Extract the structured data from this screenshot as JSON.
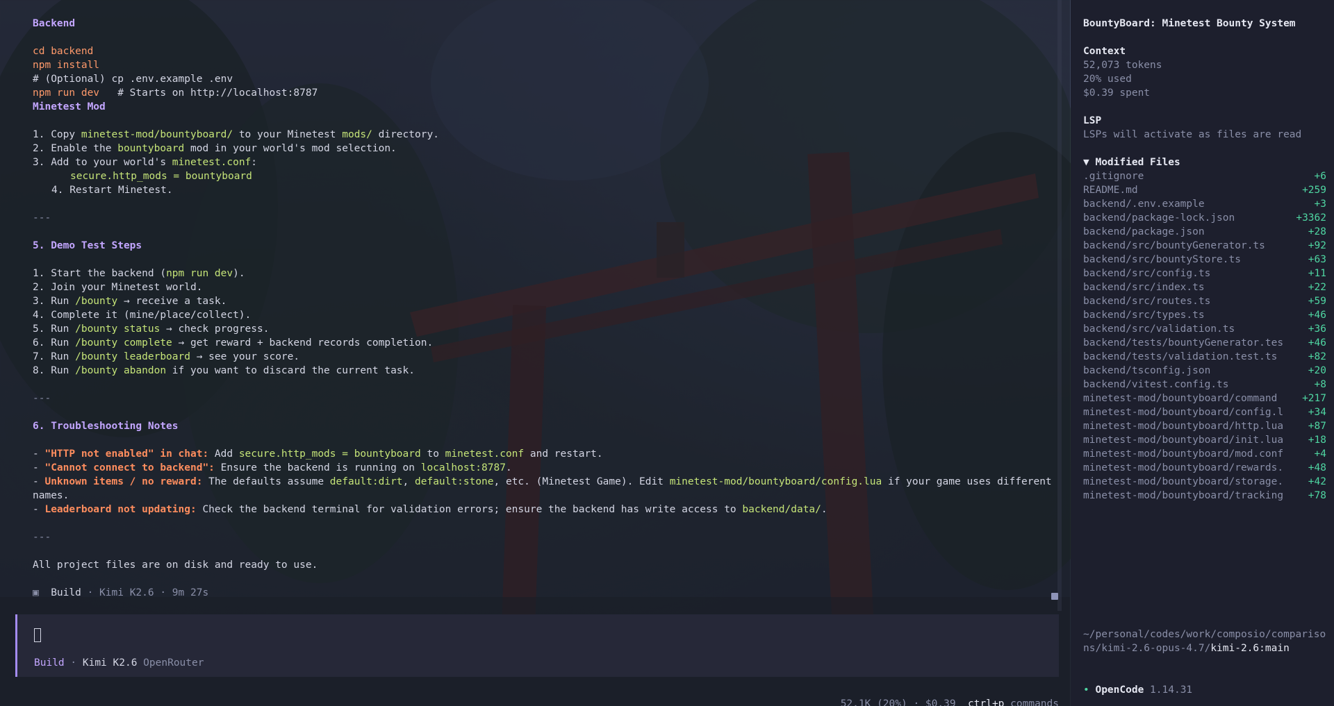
{
  "main": {
    "backend_heading": "Backend",
    "cmd_cd": "cd backend",
    "cmd_install": "npm install",
    "comment_env": "# (Optional) cp .env.example .env",
    "cmd_run": "npm run dev",
    "cmd_run_comment": "   # Starts on http://localhost:8787",
    "mod_heading": "Minetest Mod",
    "mod_step1_a": "1. Copy ",
    "mod_step1_path": "minetest-mod/bountyboard/",
    "mod_step1_b": " to your Minetest ",
    "mod_step1_mods": "mods/",
    "mod_step1_c": " directory.",
    "mod_step2_a": "2. Enable the ",
    "mod_step2_name": "bountyboard",
    "mod_step2_b": " mod in your world's mod selection.",
    "mod_step3_a": "3. Add to your world's ",
    "mod_step3_file": "minetest.conf",
    "mod_step3_b": ":",
    "mod_step3_code": "secure.http_mods = bountyboard",
    "mod_step4": "4. Restart Minetest.",
    "rule": "---",
    "demo_heading": "5. Demo Test Steps",
    "demo1_a": "1. Start the backend (",
    "demo1_cmd": "npm run dev",
    "demo1_b": ").",
    "demo2": "2. Join your Minetest world.",
    "demo3_a": "3. Run ",
    "demo3_cmd": "/bounty",
    "demo3_b": " → receive a task.",
    "demo4": "4. Complete it (mine/place/collect).",
    "demo5_a": "5. Run ",
    "demo5_cmd": "/bounty status",
    "demo5_b": " → check progress.",
    "demo6_a": "6. Run ",
    "demo6_cmd": "/bounty complete",
    "demo6_b": " → get reward + backend records completion.",
    "demo7_a": "7. Run ",
    "demo7_cmd": "/bounty leaderboard",
    "demo7_b": " → see your score.",
    "demo8_a": "8. Run ",
    "demo8_cmd": "/bounty abandon",
    "demo8_b": " if you want to discard the current task.",
    "trouble_heading": "6. Troubleshooting Notes",
    "t1_dash": "- ",
    "t1_warn": "\"HTTP not enabled\" in chat:",
    "t1_a": " Add ",
    "t1_code": "secure.http_mods = bountyboard",
    "t1_b": " to ",
    "t1_file": "minetest.conf",
    "t1_c": " and restart.",
    "t2_dash": "- ",
    "t2_warn": "\"Cannot connect to backend\":",
    "t2_a": " Ensure the backend is running on ",
    "t2_host": "localhost:8787",
    "t2_b": ".",
    "t3_dash": "- ",
    "t3_warn": "Unknown items / no reward:",
    "t3_a": " The defaults assume ",
    "t3_item1": "default:dirt",
    "t3_b": ", ",
    "t3_item2": "default:stone",
    "t3_c": ", etc. (Minetest Game). Edit ",
    "t3_file": "minetest-mod/bountyboard/config.lua",
    "t3_d": " if your game uses different names.",
    "t4_dash": "- ",
    "t4_warn": "Leaderboard not updating:",
    "t4_a": " Check the backend terminal for validation errors; ensure the backend has write access to ",
    "t4_path": "backend/data/",
    "t4_b": ".",
    "final_line": "All project files are on disk and ready to use.",
    "build_icon": "▣",
    "build_label": "Build",
    "build_meta": " · Kimi K2.6 · 9m 27s"
  },
  "input": {
    "mode": "Build",
    "sep": " · ",
    "model": "Kimi K2.6",
    "provider": "OpenRouter"
  },
  "status": {
    "usage": "52.1K (20%) · $0.39",
    "shortcut": "ctrl+p",
    "shortcut_label": " commands"
  },
  "sidebar": {
    "title": "BountyBoard: Minetest Bounty System",
    "context_label": "Context",
    "tokens": "52,073 tokens",
    "used": "20% used",
    "spent": "$0.39 spent",
    "lsp_label": "LSP",
    "lsp_text": "LSPs will activate as files are read",
    "modified_label": "▼ Modified Files",
    "files": [
      {
        "name": ".gitignore",
        "add": "+6"
      },
      {
        "name": "README.md",
        "add": "+259"
      },
      {
        "name": "backend/.env.example",
        "add": "+3"
      },
      {
        "name": "backend/package-lock.json",
        "add": "+3362"
      },
      {
        "name": "backend/package.json",
        "add": "+28"
      },
      {
        "name": "backend/src/bountyGenerator.ts",
        "add": "+92"
      },
      {
        "name": "backend/src/bountyStore.ts",
        "add": "+63"
      },
      {
        "name": "backend/src/config.ts",
        "add": "+11"
      },
      {
        "name": "backend/src/index.ts",
        "add": "+22"
      },
      {
        "name": "backend/src/routes.ts",
        "add": "+59"
      },
      {
        "name": "backend/src/types.ts",
        "add": "+46"
      },
      {
        "name": "backend/src/validation.ts",
        "add": "+36"
      },
      {
        "name": "backend/tests/bountyGenerator.tes",
        "add": "+46"
      },
      {
        "name": "backend/tests/validation.test.ts",
        "add": "+82"
      },
      {
        "name": "backend/tsconfig.json",
        "add": "+20"
      },
      {
        "name": "backend/vitest.config.ts",
        "add": "+8"
      },
      {
        "name": "minetest-mod/bountyboard/command",
        "add": "+217"
      },
      {
        "name": "minetest-mod/bountyboard/config.l",
        "add": "+34"
      },
      {
        "name": "minetest-mod/bountyboard/http.lua",
        "add": "+87"
      },
      {
        "name": "minetest-mod/bountyboard/init.lua",
        "add": "+18"
      },
      {
        "name": "minetest-mod/bountyboard/mod.conf",
        "add": "+4"
      },
      {
        "name": "minetest-mod/bountyboard/rewards.",
        "add": "+48"
      },
      {
        "name": "minetest-mod/bountyboard/storage.",
        "add": "+42"
      },
      {
        "name": "minetest-mod/bountyboard/tracking",
        "add": "+78"
      }
    ],
    "path_dim": "~/personal/codes/work/composio/comparisons/kimi-2.6-opus-4.7/",
    "path_bright": "kimi-2.6:main",
    "version_bullet": "•",
    "app_name": "OpenCode",
    "version": " 1.14.31"
  },
  "colors": {
    "heading": "#c3a6ff",
    "command": "#ff9a6b",
    "highlight": "#c5e478",
    "warning": "#ff8d5e",
    "added": "#4fd6a2",
    "sidebar_bg": "#1d1f2d",
    "input_bg": "#262838"
  }
}
